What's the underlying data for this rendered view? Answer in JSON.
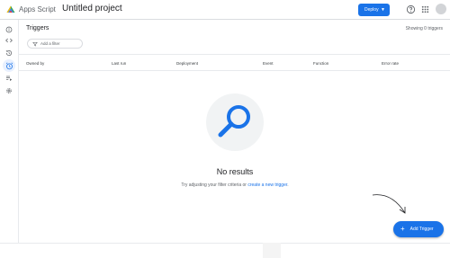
{
  "header": {
    "product_name": "Apps Script",
    "project_title": "Untitled project",
    "deploy_label": "Deploy",
    "icons": [
      "help-icon",
      "apps-grid-icon",
      "avatar"
    ]
  },
  "rail": {
    "items": [
      {
        "icon": "info-icon"
      },
      {
        "icon": "code-icon"
      },
      {
        "icon": "history-icon"
      },
      {
        "icon": "alarm-icon",
        "active": true
      },
      {
        "icon": "executions-icon"
      },
      {
        "icon": "settings-icon"
      }
    ]
  },
  "triggers": {
    "heading": "Triggers",
    "showing": "Showing 0 triggers",
    "filter_label": "Add a filter",
    "columns": [
      "Owned by",
      "Last run",
      "Deployment",
      "Event",
      "Function",
      "Error rate"
    ],
    "empty_title": "No results",
    "empty_hint_prefix": "Try adjusting your filter criteria or ",
    "empty_hint_link": "create a new trigger",
    "empty_hint_suffix": "."
  },
  "fab": {
    "label": "Add Trigger"
  },
  "colors": {
    "accent": "#1a73e8",
    "text": "#202124",
    "muted": "#5f6368",
    "divider": "#e8eaed"
  }
}
